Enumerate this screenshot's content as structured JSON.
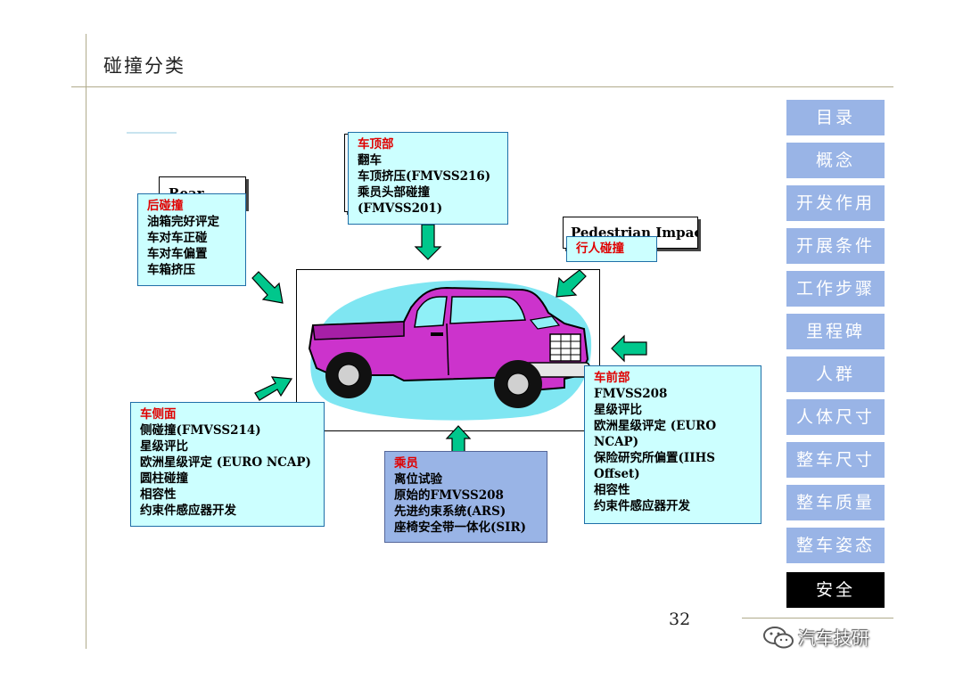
{
  "title": "碰撞分类",
  "boxes": {
    "rear": {
      "heading": "后碰撞",
      "lines": [
        "油箱完好评定",
        "车对车正碰",
        "车对车偏置",
        "车箱挤压"
      ],
      "back_label": "Rear"
    },
    "roof": {
      "heading": "车顶部",
      "lines": [
        "翻车",
        "车顶挤压(FMVSS216)",
        "乘员头部碰撞",
        "(FMVSS201)"
      ]
    },
    "pedestrian": {
      "heading": "行人碰撞",
      "back_label": "Pedestrian Impact"
    },
    "side": {
      "heading": "车侧面",
      "lines": [
        "侧碰撞(FMVSS214)",
        "星级评比",
        "欧洲星级评定 (EURO NCAP)",
        "圆柱碰撞",
        "相容性",
        "约束件感应器开发"
      ]
    },
    "occupant": {
      "heading": "乘员",
      "lines": [
        "离位试验",
        "原始的FMVSS208",
        "先进约束系统(ARS)",
        "座椅安全带一体化(SIR)"
      ]
    },
    "front": {
      "heading": "车前部",
      "lines": [
        "FMVSS208",
        "星级评比",
        "欧洲星级评定 (EURO",
        "NCAP)",
        "保险研究所偏置(IIHS",
        "Offset)",
        "相容性",
        "约束件感应器开发"
      ]
    }
  },
  "nav": [
    "目录",
    "概念",
    "开发作用",
    "开展条件",
    "工作步骤",
    "里程碑",
    "人群",
    "人体尺寸",
    "整车尺寸",
    "整车质量",
    "整车姿态",
    "安全"
  ],
  "nav_active": "安全",
  "page_number": "32",
  "watermark": "汽车技研",
  "colors": {
    "box_fill": "#ccffff",
    "occupant_fill": "#99b4e6",
    "heading_red": "#e00000",
    "nav_bg": "#99b4e6",
    "nav_active_bg": "#000000",
    "arrow_green": "#00c78c",
    "truck_magenta": "#cc33cc",
    "halo_cyan": "#66e0f0"
  },
  "icons": [
    "truck-illustration",
    "arrow-down-icon",
    "arrow-up-icon",
    "arrow-left-icon",
    "arrow-diagonal-icon",
    "wechat-icon"
  ]
}
